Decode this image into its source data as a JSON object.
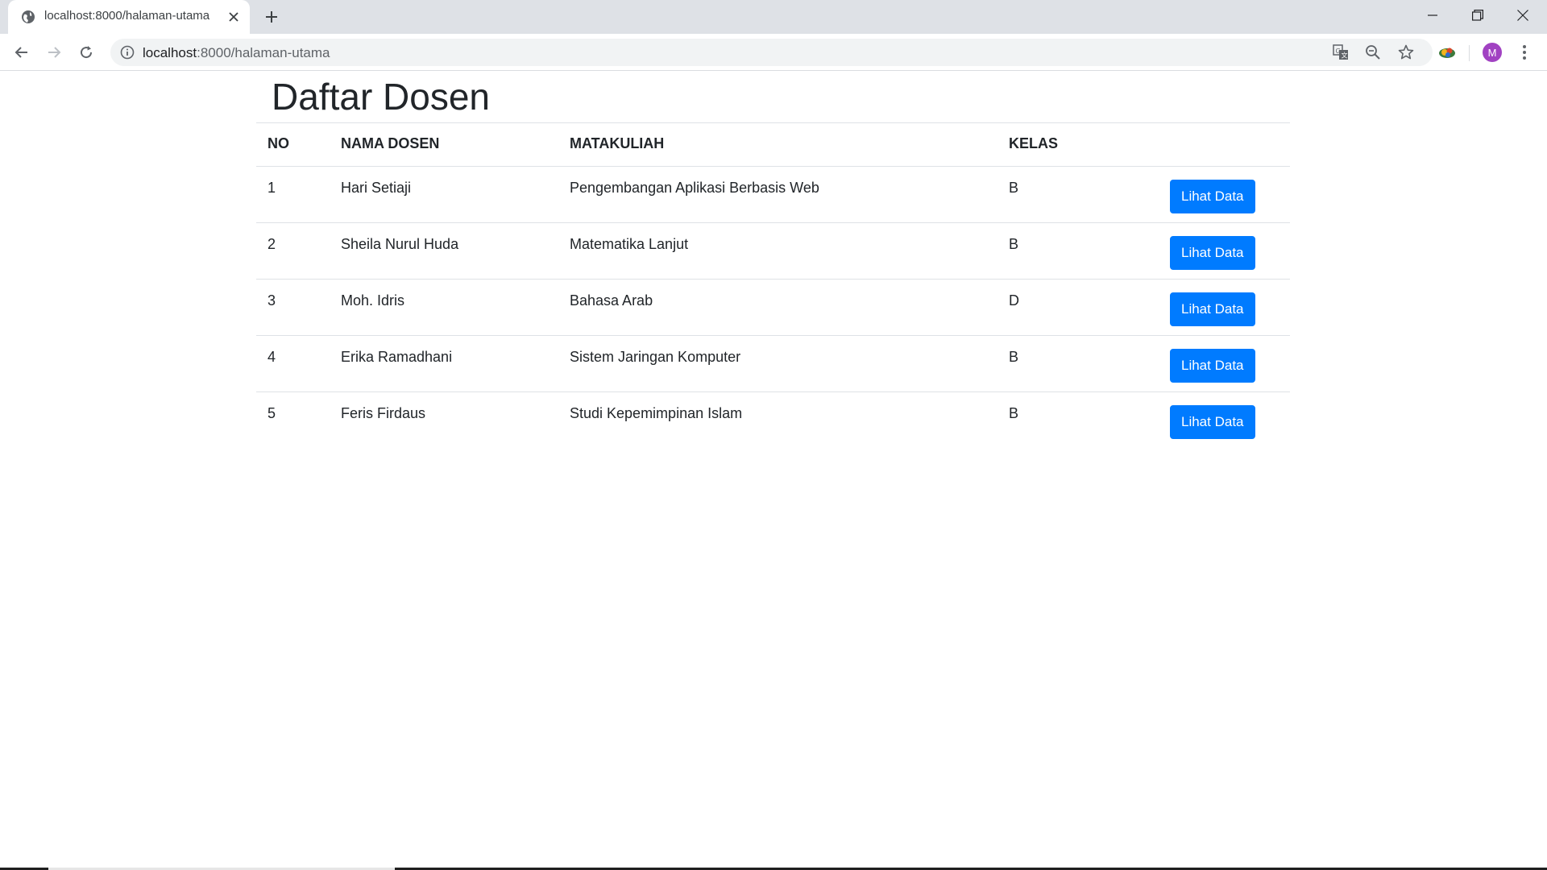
{
  "browser": {
    "tab": {
      "title": "localhost:8000/halaman-utama",
      "favicon": "globe-icon"
    },
    "address": {
      "host": "localhost",
      "path": ":8000/halaman-utama"
    },
    "avatar_letter": "M",
    "avatar_color": "#a142c2"
  },
  "page": {
    "title": "Daftar Dosen",
    "table": {
      "headers": {
        "no": "NO",
        "nama": "NAMA DOSEN",
        "matakuliah": "MATAKULIAH",
        "kelas": "KELAS"
      },
      "rows": [
        {
          "no": "1",
          "nama": "Hari Setiaji",
          "matakuliah": "Pengembangan Aplikasi Berbasis Web",
          "kelas": "B",
          "action": "Lihat Data"
        },
        {
          "no": "2",
          "nama": "Sheila Nurul Huda",
          "matakuliah": "Matematika Lanjut",
          "kelas": "B",
          "action": "Lihat Data"
        },
        {
          "no": "3",
          "nama": "Moh. Idris",
          "matakuliah": "Bahasa Arab",
          "kelas": "D",
          "action": "Lihat Data"
        },
        {
          "no": "4",
          "nama": "Erika Ramadhani",
          "matakuliah": "Sistem Jaringan Komputer",
          "kelas": "B",
          "action": "Lihat Data"
        },
        {
          "no": "5",
          "nama": "Feris Firdaus",
          "matakuliah": "Studi Kepemimpinan Islam",
          "kelas": "B",
          "action": "Lihat Data"
        }
      ]
    },
    "accent_color": "#007bff"
  }
}
